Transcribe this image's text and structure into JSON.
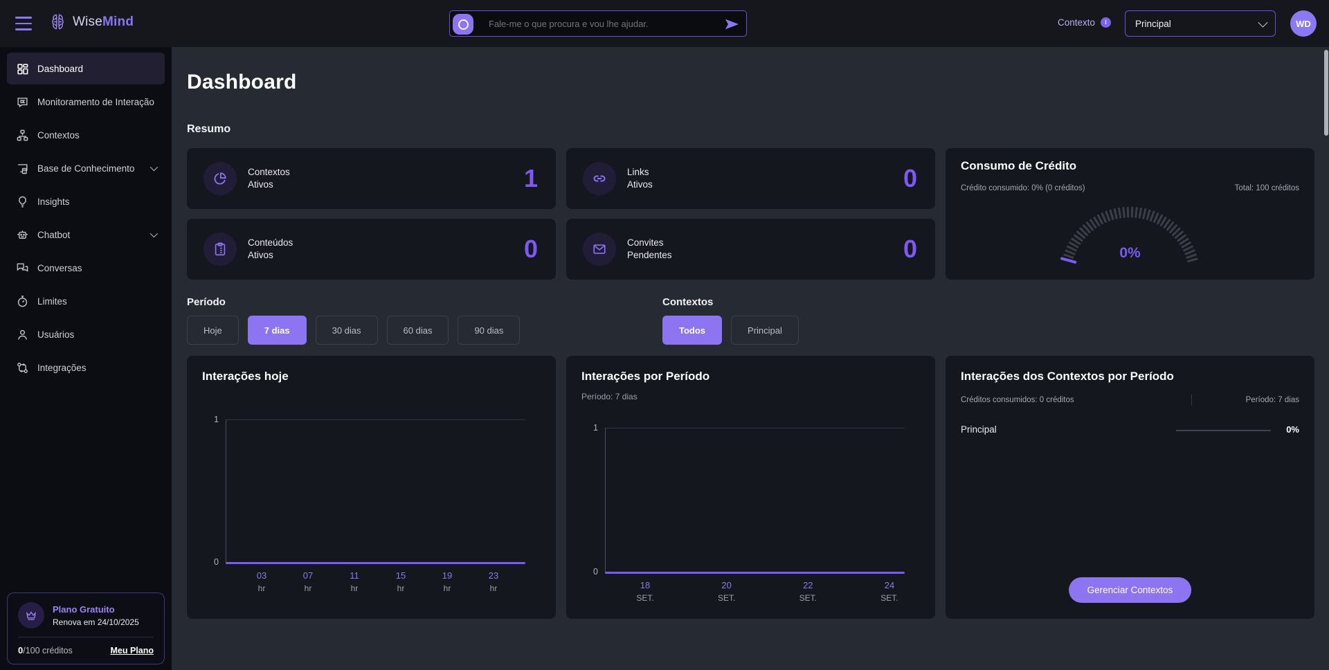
{
  "topbar": {
    "logo_wise": "Wise",
    "logo_mind": "Mind",
    "assistant_placeholder": "Fale-me o que procura e vou lhe ajudar.",
    "contexto_label": "Contexto",
    "context_selected": "Principal",
    "avatar_initials": "WD"
  },
  "sidebar": {
    "items": [
      {
        "label": "Dashboard",
        "icon": "dashboard-grid",
        "active": true
      },
      {
        "label": "Monitoramento de Interação",
        "icon": "chat-monitor"
      },
      {
        "label": "Contextos",
        "icon": "hierarchy"
      },
      {
        "label": "Base de Conhecimento",
        "icon": "devices",
        "expandable": true
      },
      {
        "label": "Insights",
        "icon": "lightbulb"
      },
      {
        "label": "Chatbot",
        "icon": "robot",
        "expandable": true
      },
      {
        "label": "Conversas",
        "icon": "chat-bubbles"
      },
      {
        "label": "Limites",
        "icon": "stopwatch"
      },
      {
        "label": "Usuários",
        "icon": "user"
      },
      {
        "label": "Integrações",
        "icon": "integrations"
      }
    ],
    "plan": {
      "title": "Plano Gratuito",
      "renewal": "Renova em 24/10/2025",
      "credits_used": "0",
      "credits_suffix": "/100 créditos",
      "link": "Meu Plano"
    }
  },
  "main": {
    "page_title": "Dashboard",
    "resumo_title": "Resumo",
    "stats": [
      {
        "line1": "Contextos",
        "line2": "Ativos",
        "value": "1",
        "icon": "pie-chart"
      },
      {
        "line1": "Links",
        "line2": "Ativos",
        "value": "0",
        "icon": "link"
      },
      {
        "line1": "Conteúdos",
        "line2": "Ativos",
        "value": "0",
        "icon": "clipboard"
      },
      {
        "line1": "Convites",
        "line2": "Pendentes",
        "value": "0",
        "icon": "envelope"
      }
    ],
    "credit": {
      "title": "Consumo de Crédito",
      "consumed": "Crédito consumido: 0% (0 créditos)",
      "total": "Total: 100 créditos",
      "percent": "0%"
    },
    "filters": {
      "periodo": {
        "label": "Período",
        "options": [
          "Hoje",
          "7 dias",
          "30 dias",
          "60 dias",
          "90 dias"
        ],
        "selected": "7 dias"
      },
      "contextos": {
        "label": "Contextos",
        "options": [
          "Todos",
          "Principal"
        ],
        "selected": "Todos"
      }
    }
  },
  "chart_data": {
    "today": {
      "type": "line",
      "title": "Interações hoje",
      "y_max": "1",
      "y_min": "0",
      "ylim": [
        0,
        1
      ],
      "x": [
        "03 hr",
        "07 hr",
        "11 hr",
        "15 hr",
        "19 hr",
        "23 hr"
      ],
      "values": [
        0,
        0,
        0,
        0,
        0,
        0
      ],
      "ticks": [
        {
          "v": "03",
          "u": "hr"
        },
        {
          "v": "07",
          "u": "hr"
        },
        {
          "v": "11",
          "u": "hr"
        },
        {
          "v": "15",
          "u": "hr"
        },
        {
          "v": "19",
          "u": "hr"
        },
        {
          "v": "23",
          "u": "hr"
        }
      ]
    },
    "period": {
      "type": "line",
      "title": "Interações por Período",
      "subtitle": "Período: 7 dias",
      "y_max": "1",
      "y_min": "0",
      "ylim": [
        0,
        1
      ],
      "x": [
        "18 SET.",
        "20 SET.",
        "22 SET.",
        "24 SET."
      ],
      "values": [
        0,
        0,
        0,
        0
      ],
      "ticks": [
        {
          "v": "18",
          "u": "SET."
        },
        {
          "v": "20",
          "u": "SET."
        },
        {
          "v": "22",
          "u": "SET."
        },
        {
          "v": "24",
          "u": "SET."
        }
      ]
    },
    "contexts": {
      "type": "bar",
      "title": "Interações dos Contextos por Período",
      "credits_meta": "Créditos consumidos: 0 créditos",
      "period_meta": "Período: 7 dias",
      "rows": [
        {
          "name": "Principal",
          "value": "0%"
        }
      ],
      "button": "Gerenciar Contextos"
    }
  }
}
